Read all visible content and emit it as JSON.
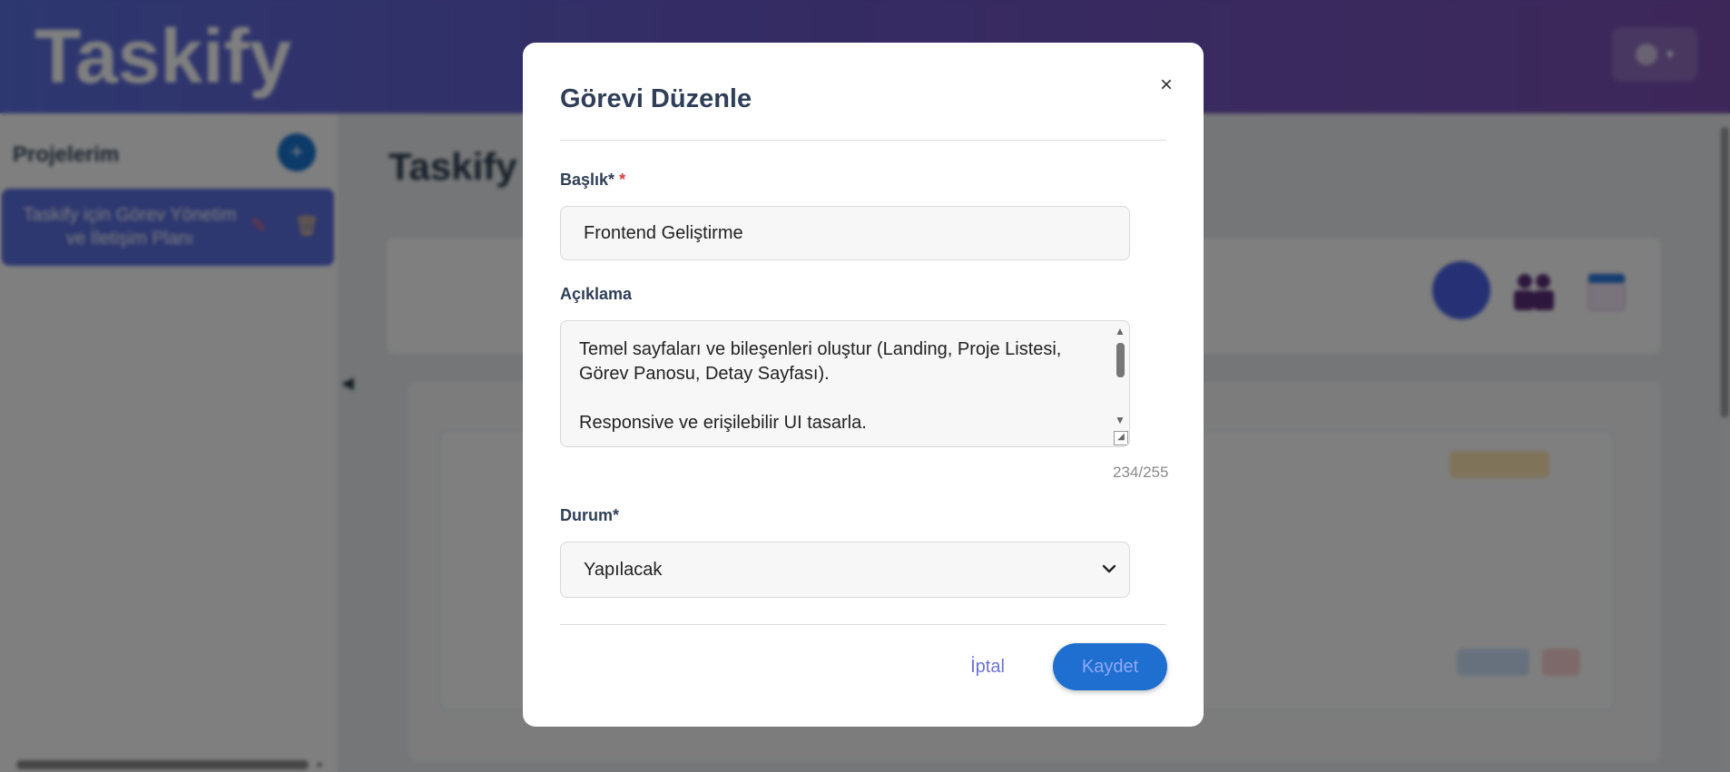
{
  "header": {
    "logo": "Taskify"
  },
  "sidebar": {
    "title": "Projelerim",
    "add_label": "+",
    "projects": [
      {
        "name": "Taskify için Görev Yönetim ve İletişim Planı"
      }
    ]
  },
  "main": {
    "title": "Taskify i"
  },
  "modal": {
    "title": "Görevi Düzenle",
    "close_label": "×",
    "title_field": {
      "label": "Başlık*",
      "required_mark": "*",
      "value": "Frontend Geliştirme"
    },
    "description_field": {
      "label": "Açıklama",
      "value": "Temel sayfaları ve bileşenleri oluştur (Landing, Proje Listesi, Görev Panosu, Detay Sayfası).\n\nResponsive ve erişilebilir UI tasarla.",
      "char_count": "234/255"
    },
    "status_field": {
      "label": "Durum*",
      "selected": "Yapılacak"
    },
    "buttons": {
      "cancel": "İptal",
      "save": "Kaydet"
    }
  },
  "colors": {
    "header_gradient_start": "#5b6fe0",
    "header_gradient_end": "#7b4fb3",
    "save_button": "#1f6fd0",
    "required": "#e53935"
  }
}
